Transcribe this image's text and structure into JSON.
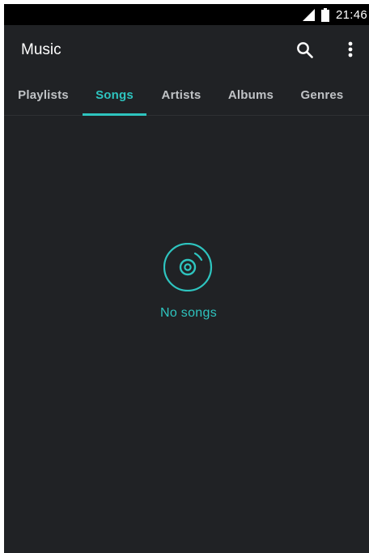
{
  "status_bar": {
    "time": "21:46",
    "signal_icon": "cellular-signal-icon",
    "battery_icon": "battery-icon"
  },
  "app_bar": {
    "title": "Music",
    "search_icon": "search-icon",
    "menu_icon": "more-vert-icon"
  },
  "tabs": [
    {
      "label": "Playlists",
      "active": false
    },
    {
      "label": "Songs",
      "active": true
    },
    {
      "label": "Artists",
      "active": false
    },
    {
      "label": "Albums",
      "active": false
    },
    {
      "label": "Genres",
      "active": false
    }
  ],
  "empty_state": {
    "icon": "disc-icon",
    "message": "No songs"
  },
  "colors": {
    "background": "#202225",
    "status_bar": "#000000",
    "accent": "#2ec4bf",
    "tab_inactive": "#c0c3c6",
    "title_text": "#ffffff"
  }
}
